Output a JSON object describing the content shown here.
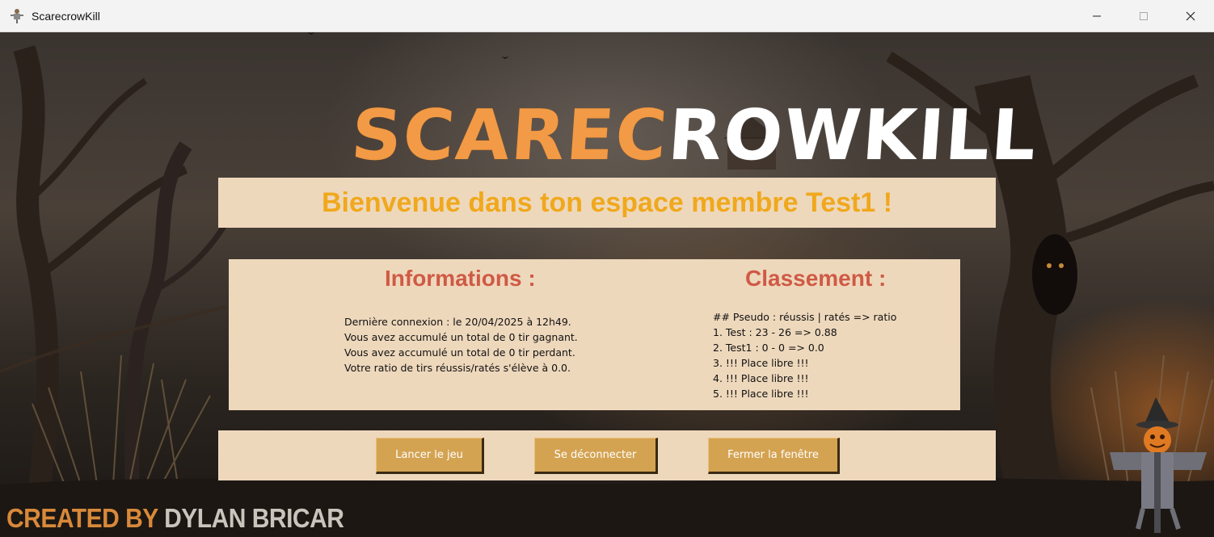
{
  "window": {
    "title": "ScarecrowKill",
    "controls": [
      "minimize-icon",
      "maximize-icon",
      "close-icon"
    ]
  },
  "logo": {
    "part1": "SCAREC",
    "part2": "ROWKILL",
    "colors": {
      "part1": "#f29a45",
      "part2": "#ffffff"
    }
  },
  "welcome": {
    "text": "Bienvenue dans ton espace membre Test1 !",
    "color": "#f0a81c"
  },
  "informations": {
    "title": "Informations :",
    "lines": [
      "Dernière connexion : le 20/04/2025 à 12h49.",
      "Vous avez accumulé un total de 0 tir gagnant.",
      "Vous avez accumulé un total de 0 tir perdant.",
      "Votre ratio de tirs réussis/ratés s'élève à 0.0."
    ]
  },
  "classement": {
    "title": "Classement :",
    "header": "## Pseudo : réussis | ratés => ratio",
    "entries": [
      "1. Test : 23 - 26 => 0.88",
      "2. Test1 : 0 - 0 => 0.0",
      "3. !!! Place libre !!!",
      "4. !!! Place libre !!!",
      "5. !!! Place libre !!!"
    ]
  },
  "buttons": {
    "play": "Lancer le jeu",
    "logout": "Se déconnecter",
    "close": "Fermer la fenêtre"
  },
  "credit": {
    "prefix": "CREATED BY",
    "author": "DYLAN BRICAR"
  },
  "colors": {
    "panel": "#eed8bc",
    "section_title": "#cf5a45",
    "button": "#d4a352"
  }
}
